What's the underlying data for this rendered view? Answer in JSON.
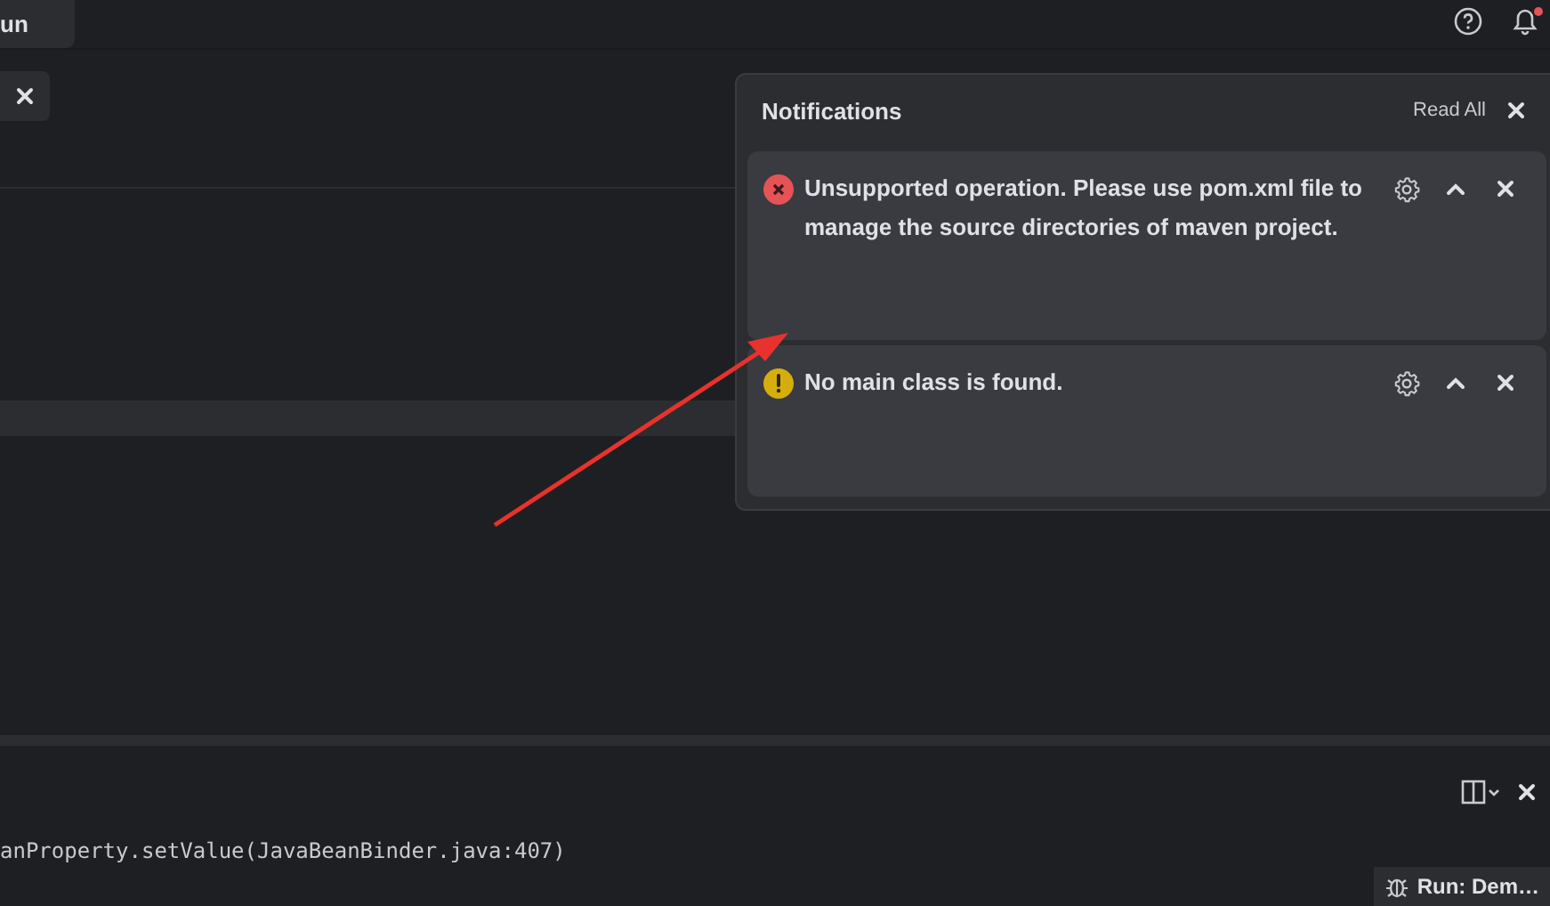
{
  "top_bar": {
    "tab_label": "un",
    "bell_unread": true
  },
  "console": {
    "line": "anProperty.setValue(JavaBeanBinder.java:407)"
  },
  "status_bar": {
    "run_label": "Run: Dem…"
  },
  "notifications": {
    "title": "Notifications",
    "read_all": "Read All",
    "items": [
      {
        "kind": "error",
        "message": "Unsupported operation. Please use pom.xml file to manage the source directories of maven project."
      },
      {
        "kind": "warning",
        "message": "No main class is found."
      }
    ]
  }
}
